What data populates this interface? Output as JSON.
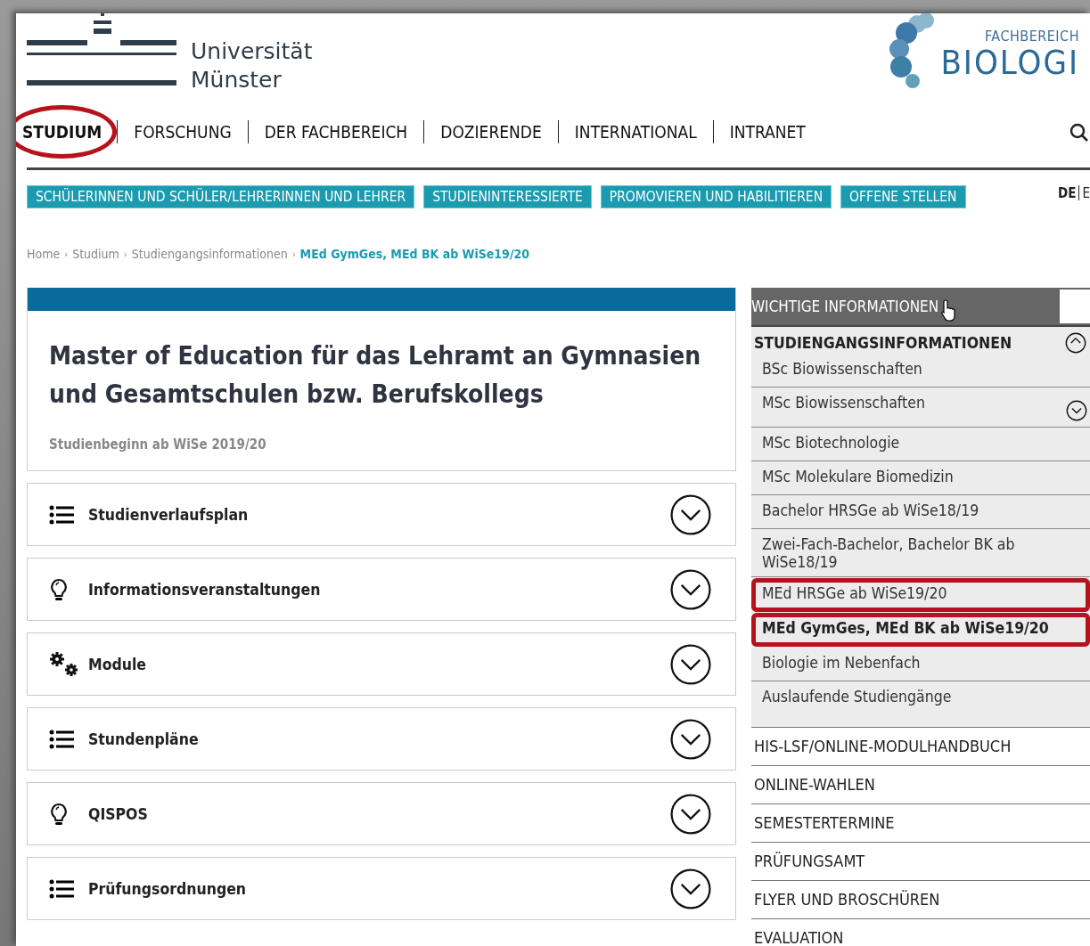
{
  "header": {
    "university_name": [
      "Universität",
      "Münster"
    ],
    "faculty_label": "FACHBEREICH",
    "faculty_name": "BIOLOGI"
  },
  "main_nav": [
    {
      "label": "STUDIUM",
      "selected": true,
      "annotated": true
    },
    {
      "label": "FORSCHUNG",
      "selected": false,
      "annotated": false
    },
    {
      "label": "DER FACHBEREICH",
      "selected": false,
      "annotated": false
    },
    {
      "label": "DOZIERENDE",
      "selected": false,
      "annotated": false
    },
    {
      "label": "INTERNATIONAL",
      "selected": false,
      "annotated": false
    },
    {
      "label": "INTRANET",
      "selected": false,
      "annotated": false
    }
  ],
  "sub_nav": [
    "SCHÜLERINNEN UND SCHÜLER/LEHRERINNEN UND LEHRER",
    "STUDIENINTERESSIERTE",
    "PROMOVIEREN UND HABILITIEREN",
    "OFFENE STELLEN"
  ],
  "languages": [
    {
      "label": "DE",
      "selected": true
    },
    {
      "label": "E",
      "selected": false
    }
  ],
  "breadcrumb": {
    "separator": "›",
    "items": [
      "Home",
      "Studium",
      "Studiengangsinformationen",
      "MEd GymGes, MEd BK ab WiSe19/20"
    ]
  },
  "page": {
    "title": "Master of Education für das Lehramt an Gymnasien und Gesamtschulen bzw. Berufskollegs",
    "subtitle": "Studienbeginn ab WiSe 2019/20"
  },
  "sections": [
    {
      "kind": "list",
      "label": "Studienverlaufsplan",
      "expanded": false
    },
    {
      "kind": "bulb",
      "label": "Informationsveranstaltungen",
      "expanded": false
    },
    {
      "kind": "gears",
      "label": "Module",
      "expanded": false
    },
    {
      "kind": "list",
      "label": "Stundenpläne",
      "expanded": false
    },
    {
      "kind": "bulb",
      "label": "QISPOS",
      "expanded": false
    },
    {
      "kind": "list",
      "label": "Prüfungsordnungen",
      "expanded": false
    }
  ],
  "sidebar": {
    "title": "WICHTIGE INFORMATIONEN",
    "groups": [
      {
        "label": "STUDIENGANGSINFORMATIONEN",
        "expanded": true,
        "children": [
          {
            "label": "BSc Biowissenschaften",
            "selected": false,
            "annotated": false
          },
          {
            "label": "MSc Biowissenschaften",
            "selected": false,
            "annotated": false,
            "expanded": false
          },
          {
            "label": "MSc Biotechnologie",
            "selected": false,
            "annotated": false
          },
          {
            "label": "MSc Molekulare Biomedizin",
            "selected": false,
            "annotated": false
          },
          {
            "label": "Bachelor HRSGe ab WiSe18/19",
            "selected": false,
            "annotated": false
          },
          {
            "label": "Zwei-Fach-Bachelor, Bachelor BK ab WiSe18/19",
            "selected": false,
            "annotated": false
          },
          {
            "label": "MEd HRSGe ab WiSe19/20",
            "selected": false,
            "annotated": true
          },
          {
            "label": "MEd GymGes, MEd BK ab WiSe19/20",
            "selected": true,
            "annotated": true
          },
          {
            "label": "Biologie im Nebenfach",
            "selected": false,
            "annotated": false
          },
          {
            "label": "Auslaufende Studiengänge",
            "selected": false,
            "annotated": false
          }
        ]
      }
    ],
    "links": [
      "HIS-LSF/ONLINE-MODULHANDBUCH",
      "ONLINE-WAHLEN",
      "SEMESTERTERMINE",
      "PRÜFUNGSAMT",
      "FLYER UND BROSCHÜREN",
      "EVALUATION"
    ]
  }
}
